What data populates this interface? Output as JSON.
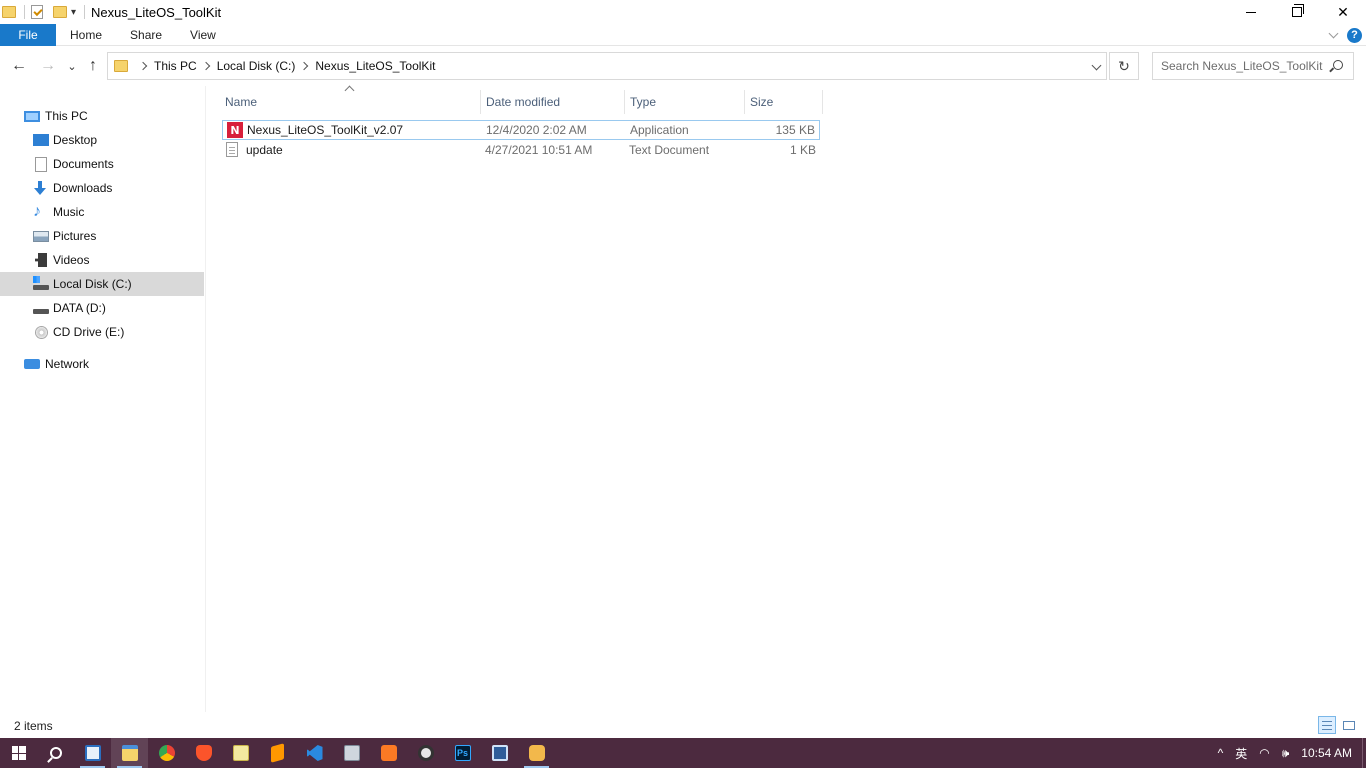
{
  "window": {
    "title": "Nexus_LiteOS_ToolKit",
    "minimize_glyph": "",
    "close_glyph": "✕"
  },
  "ribbon": {
    "tabs": [
      {
        "label": "File"
      },
      {
        "label": "Home"
      },
      {
        "label": "Share"
      },
      {
        "label": "View"
      }
    ],
    "help_label": "?"
  },
  "navigation": {
    "back_glyph": "←",
    "forward_glyph": "→",
    "recent_glyph": "⌄",
    "up_glyph": "↑",
    "refresh_glyph": "↻"
  },
  "address": {
    "crumbs": [
      "This PC",
      "Local Disk (C:)",
      "Nexus_LiteOS_ToolKit"
    ]
  },
  "search": {
    "placeholder": "Search Nexus_LiteOS_ToolKit"
  },
  "sidebar": {
    "items": [
      {
        "label": "This PC",
        "icon": "computer-icon"
      },
      {
        "label": "Desktop",
        "icon": "desktop-icon"
      },
      {
        "label": "Documents",
        "icon": "documents-icon"
      },
      {
        "label": "Downloads",
        "icon": "download-icon"
      },
      {
        "label": "Music",
        "icon": "music-icon"
      },
      {
        "label": "Pictures",
        "icon": "pictures-icon"
      },
      {
        "label": "Videos",
        "icon": "video-icon"
      },
      {
        "label": "Local Disk (C:)",
        "icon": "disk-icon",
        "selected": true
      },
      {
        "label": "DATA (D:)",
        "icon": "disk-icon"
      },
      {
        "label": "CD Drive (E:)",
        "icon": "cd-icon"
      },
      {
        "label": "Network",
        "icon": "network-icon"
      }
    ]
  },
  "files": {
    "columns": [
      "Name",
      "Date modified",
      "Type",
      "Size"
    ],
    "rows": [
      {
        "name": "Nexus_LiteOS_ToolKit_v2.07",
        "date": "12/4/2020 2:02 AM",
        "type": "Application",
        "size": "135 KB",
        "icon": "application-icon",
        "icon_letter": "N"
      },
      {
        "name": "update",
        "date": "4/27/2021 10:51 AM",
        "type": "Text Document",
        "size": "1 KB",
        "icon": "text-document-icon"
      }
    ]
  },
  "status": {
    "item_count": "2 items"
  },
  "taskbar": {
    "apps": [
      "start-icon",
      "search-icon",
      "task-view-icon",
      "file-explorer-icon",
      "chrome-icon",
      "brave-icon",
      "notepad-icon",
      "sublime-icon",
      "vscode-icon",
      "network-tool-icon",
      "xampp-icon",
      "obs-icon",
      "photoshop-icon",
      "rdp-icon",
      "app-icon"
    ],
    "ps_label": "Ps",
    "clock": "10:54 AM",
    "tray_up": "^",
    "tray_ime": "英",
    "tray_wifi": "◠",
    "tray_volume": "🕪"
  },
  "colors": {
    "accent": "#1979ca",
    "taskbar_bg": "#4c2a3f",
    "selected_nav": "#d9d9d9",
    "app_icon_red": "#d81f3b"
  }
}
